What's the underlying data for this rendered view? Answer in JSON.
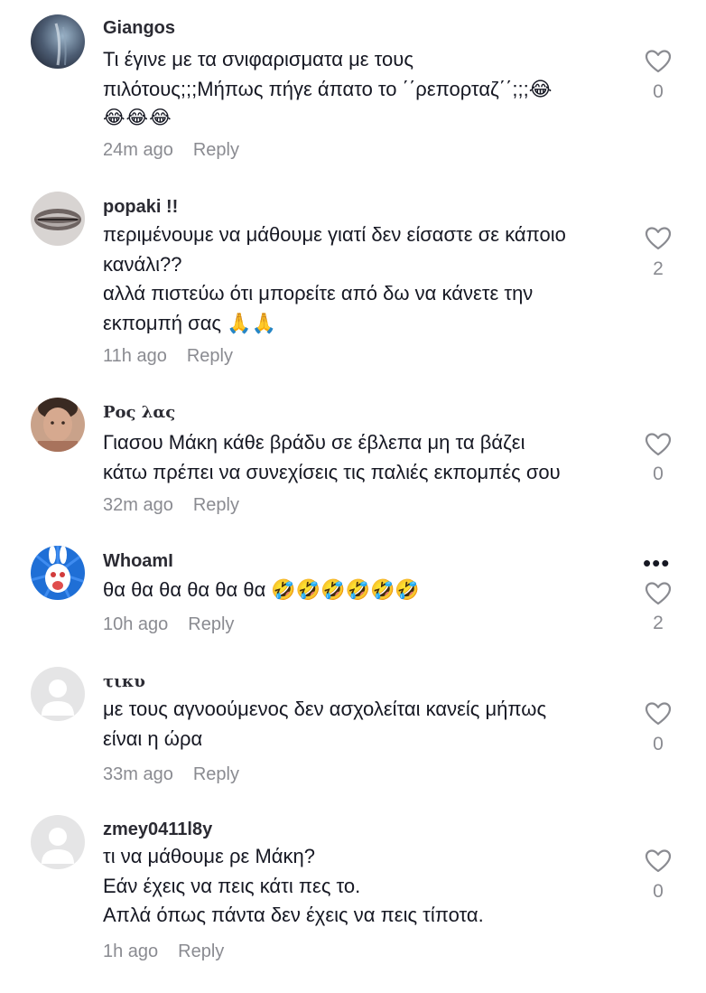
{
  "comments": [
    {
      "username": "Giangos",
      "lines": [
        "Τι έγινε με τα σνιφαρισματα με τους",
        "πιλότους;;;Μήπως πήγε άπατο το ΄΄ρεπορταζ΄΄;;;😂",
        "😂😂😂"
      ],
      "time": "24m ago",
      "reply": "Reply",
      "likes": "0"
    },
    {
      "username": "popaki !!",
      "lines": [
        "περιμένουμε να μάθουμε γιατί δεν είσαστε σε κάποιο",
        "κανάλι??",
        "αλλά πιστεύω ότι μπορείτε από δω να κάνετε την",
        "εκπομπή σας 🙏🙏"
      ],
      "time": "11h ago",
      "reply": "Reply",
      "likes": "2"
    },
    {
      "username": "Ρος λας",
      "lines": [
        "Γιασου Μάκη κάθε βράδυ σε έβλεπα μη τα βάζει",
        "κάτω πρέπει να συνεχίσεις τις παλιές εκπομπές σου"
      ],
      "time": "32m ago",
      "reply": "Reply",
      "likes": "0"
    },
    {
      "username": "WhoamI",
      "lines": [
        "θα θα θα θα θα θα 🤣🤣🤣🤣🤣🤣"
      ],
      "time": "10h ago",
      "reply": "Reply",
      "likes": "2",
      "more": "•••"
    },
    {
      "username": "τικυ",
      "lines": [
        "με τους αγνοούμενος δεν ασχολείται κανείς μήπως",
        "είναι η ώρα"
      ],
      "time": "33m ago",
      "reply": "Reply",
      "likes": "0"
    },
    {
      "username": "zmey0411l8y",
      "lines": [
        "τι να μάθουμε ρε Μάκη?",
        "Εάν έχεις να πεις κάτι πες το.",
        "Απλά όπως πάντα δεν έχεις να πεις τίποτα."
      ],
      "time": "1h ago",
      "reply": "Reply",
      "likes": "0"
    }
  ],
  "icons": {
    "like": "heart-outline-icon",
    "more": "more-options-icon"
  },
  "colors": {
    "text": "#161823",
    "muted": "#8a8b91",
    "background": "#ffffff"
  }
}
